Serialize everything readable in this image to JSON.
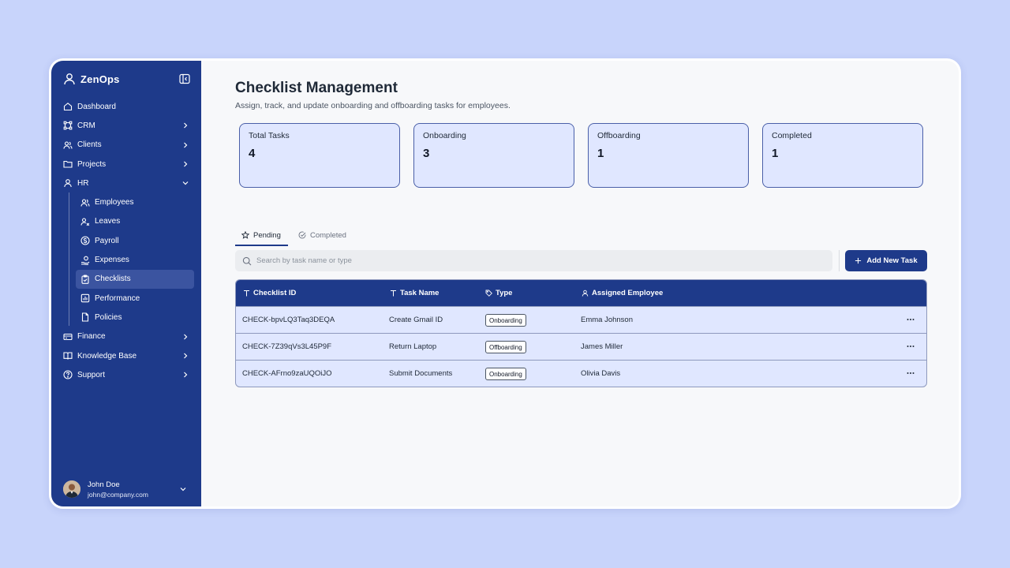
{
  "brand": {
    "name": "ZenOps"
  },
  "sidebar": {
    "items": [
      {
        "label": "Dashboard",
        "icon": "home-icon"
      },
      {
        "label": "CRM",
        "icon": "crm-icon"
      },
      {
        "label": "Clients",
        "icon": "users-icon"
      },
      {
        "label": "Projects",
        "icon": "folder-icon"
      },
      {
        "label": "HR",
        "icon": "user-icon"
      }
    ],
    "hr_sub": [
      {
        "label": "Employees",
        "icon": "users-icon"
      },
      {
        "label": "Leaves",
        "icon": "user-x-icon"
      },
      {
        "label": "Payroll",
        "icon": "dollar-icon"
      },
      {
        "label": "Expenses",
        "icon": "expenses-icon"
      },
      {
        "label": "Checklists",
        "icon": "clipboard-check-icon"
      },
      {
        "label": "Performance",
        "icon": "chart-icon"
      },
      {
        "label": "Policies",
        "icon": "file-icon"
      }
    ],
    "bottom_items": [
      {
        "label": "Finance",
        "icon": "card-icon"
      },
      {
        "label": "Knowledge Base",
        "icon": "book-icon"
      },
      {
        "label": "Support",
        "icon": "help-icon"
      }
    ]
  },
  "user": {
    "name": "John Doe",
    "email": "john@company.com"
  },
  "page": {
    "title": "Checklist Management",
    "subtitle": "Assign, track, and update onboarding and offboarding tasks for employees."
  },
  "stats": [
    {
      "label": "Total Tasks",
      "value": "4"
    },
    {
      "label": "Onboarding",
      "value": "3"
    },
    {
      "label": "Offboarding",
      "value": "1"
    },
    {
      "label": "Completed",
      "value": "1"
    }
  ],
  "tabs": {
    "pending": "Pending",
    "completed": "Completed"
  },
  "search": {
    "placeholder": "Search by task name or type"
  },
  "add_button": {
    "label": "Add New Task"
  },
  "table": {
    "headers": [
      "Checklist ID",
      "Task Name",
      "Type",
      "Assigned Employee"
    ],
    "rows": [
      {
        "id": "CHECK-bpvLQ3Taq3DEQA",
        "task": "Create Gmail ID",
        "type": "Onboarding",
        "employee": "Emma Johnson"
      },
      {
        "id": "CHECK-7Z39qVs3L45P9F",
        "task": "Return Laptop",
        "type": "Offboarding",
        "employee": "James Miller"
      },
      {
        "id": "CHECK-AFrno9zaUQOiJO",
        "task": "Submit Documents",
        "type": "Onboarding",
        "employee": "Olivia Davis"
      }
    ]
  }
}
